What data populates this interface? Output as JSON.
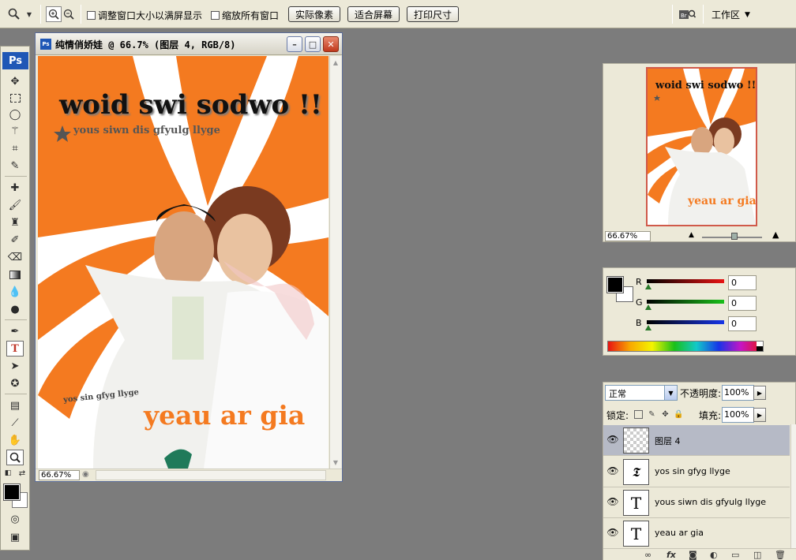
{
  "options_bar": {
    "zoom_tool_icon": "zoom-icon",
    "checkbox_resize": "调整窗口大小以满屏显示",
    "checkbox_zoom_all": "缩放所有窗口",
    "btn_actual": "实际像素",
    "btn_fit": "适合屏幕",
    "btn_print": "打印尺寸",
    "workspace": "工作区"
  },
  "toolbox": {
    "logo": "Ps"
  },
  "document": {
    "title": "纯情俏娇娃 @ 66.7% (图层 4, RGB/8)",
    "zoom": "66.67%",
    "art": {
      "headline": "woid swi sodwo !!",
      "subline": "yous siwn dis gfyulg llyge",
      "small_text": "yos sin gfyg llyge",
      "bottom_text": "yeau ar gia",
      "accent": "#f47a20"
    }
  },
  "navigator": {
    "zoom": "66.67%"
  },
  "color_panel": {
    "r_label": "R",
    "g_label": "G",
    "b_label": "B",
    "r_value": "0",
    "g_value": "0",
    "b_value": "0"
  },
  "layers_panel": {
    "blend_mode": "正常",
    "opacity_label": "不透明度:",
    "opacity_value": "100%",
    "lock_label": "锁定:",
    "fill_label": "填充:",
    "fill_value": "100%",
    "layers": [
      {
        "name": "图层 4",
        "type": "raster"
      },
      {
        "name": "yos sin gfyg llyge",
        "type": "warp-text"
      },
      {
        "name": "yous siwn dis gfyulg llyge",
        "type": "text"
      },
      {
        "name": "yeau ar gia",
        "type": "text"
      }
    ],
    "footer_fx": "fx"
  }
}
